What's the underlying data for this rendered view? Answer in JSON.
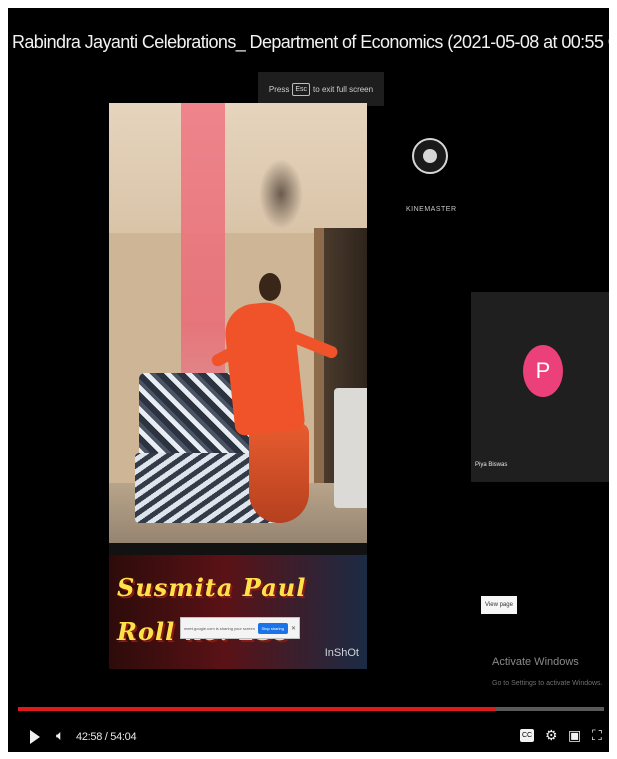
{
  "window": {
    "title": "Rabindra Jayanti Celebrations_ Department of Economics (2021-05-08 at 00:55 GMT-7)"
  },
  "fullscreen_hint": {
    "prefix": "Press",
    "key": "Esc",
    "suffix": "to exit full screen"
  },
  "video": {
    "caption_line1": "Susmita Paul",
    "caption_line2": "Roll no: 239",
    "watermark": "InShOt"
  },
  "dialog": {
    "text": "meet.google.com is sharing your screen.",
    "primary_button": "Stop sharing",
    "close_icon": "close-icon"
  },
  "kinemaster": {
    "text": "KINEMASTER"
  },
  "participant": {
    "avatar_letter": "P",
    "name": "Piya Biswas",
    "avatar_color": "#ec407a"
  },
  "view_button": {
    "label": "View page"
  },
  "activate_windows": {
    "title": "Activate Windows",
    "subtitle": "Go to Settings to activate Windows."
  },
  "player": {
    "time": "42:58 / 54:04",
    "progress_fraction": 0.816,
    "accent_color": "#e01a1a",
    "icons": [
      "play-icon",
      "volume-icon",
      "subtitles-icon",
      "settings-icon",
      "miniplayer-icon",
      "fullscreen-icon"
    ]
  }
}
